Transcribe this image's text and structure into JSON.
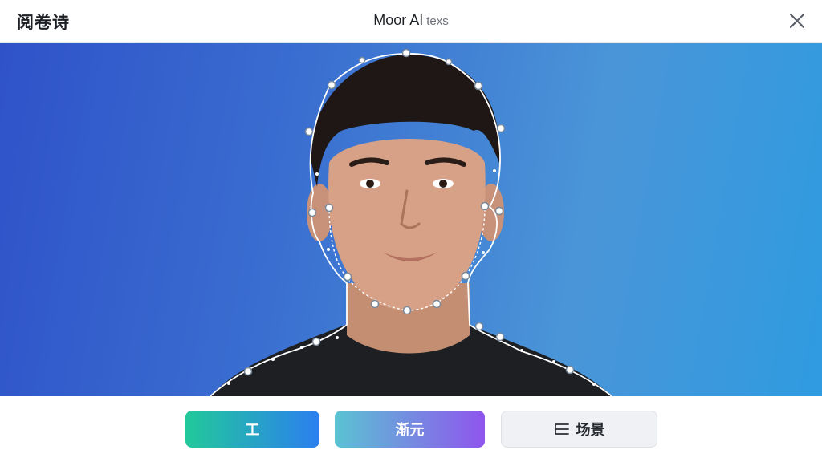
{
  "header": {
    "left_title": "阅卷诗",
    "center_title": "Moor AI",
    "center_subtitle": "texs",
    "close_icon": "close-icon"
  },
  "stage": {
    "background_colors": [
      "#2f52c9",
      "#4a95d8",
      "#2f9be0"
    ],
    "contour_color": "#ffffff",
    "image_description_icon": "portrait-photo"
  },
  "toolbar": {
    "buttons": [
      {
        "label": "工"
      },
      {
        "label": "渐元"
      },
      {
        "label": "场景",
        "icon": "list-icon"
      }
    ]
  }
}
